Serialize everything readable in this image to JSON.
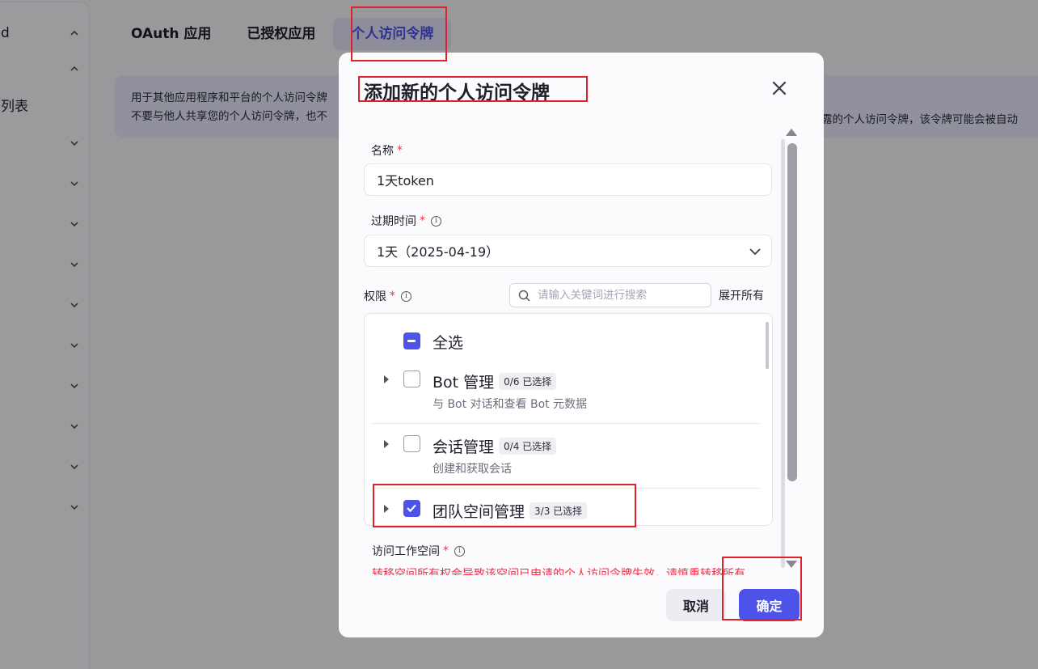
{
  "sidebar": {
    "items": [
      {
        "label": "d",
        "chevron": "chevron-up-icon"
      },
      {
        "label": "",
        "chevron": "chevron-up-icon"
      },
      {
        "label": "列表",
        "chevron": ""
      },
      {
        "label": "",
        "chevron": "chevron-down-icon"
      },
      {
        "label": "",
        "chevron": "chevron-down-icon"
      },
      {
        "label": "",
        "chevron": "chevron-down-icon"
      },
      {
        "label": "",
        "chevron": "chevron-down-icon"
      },
      {
        "label": "",
        "chevron": "chevron-down-icon"
      },
      {
        "label": "",
        "chevron": "chevron-down-icon"
      },
      {
        "label": "",
        "chevron": "chevron-down-icon"
      },
      {
        "label": "",
        "chevron": "chevron-down-icon"
      },
      {
        "label": "",
        "chevron": "chevron-down-icon"
      }
    ]
  },
  "tabs": [
    {
      "label": "OAuth 应用",
      "active": false
    },
    {
      "label": "已授权应用",
      "active": false
    },
    {
      "label": "个人访问令牌",
      "active": true
    }
  ],
  "banner": {
    "line1": "用于其他应用程序和平台的个人访问令牌",
    "line2": "不要与他人共享您的个人访问令牌，也不",
    "line2_tail": "露的个人访问令牌，该令牌可能会被自动"
  },
  "modal": {
    "title": "添加新的个人访问令牌",
    "name_label": "名称",
    "name_value": "1天token",
    "expiry_label": "过期时间",
    "expiry_value": "1天（2025-04-19）",
    "perm_label": "权限",
    "search_placeholder": "请输入关键词进行搜索",
    "expand_all": "展开所有",
    "select_all": "全选",
    "permissions": [
      {
        "name": "Bot 管理",
        "badge": "0/6 已选择",
        "desc": "与 Bot 对话和查看 Bot 元数据",
        "state": "unchecked"
      },
      {
        "name": "会话管理",
        "badge": "0/4 已选择",
        "desc": "创建和获取会话",
        "state": "unchecked"
      },
      {
        "name": "团队空间管理",
        "badge": "3/3 已选择",
        "desc": "",
        "state": "checked"
      }
    ],
    "workspace_label": "访问工作空间",
    "warning": "转移空间所有权会导致该空间已申请的个人访问令牌失效，请慎重转移所有",
    "cancel": "取消",
    "confirm": "确定"
  },
  "colors": {
    "accent": "#4d53e8",
    "required": "#f3304a",
    "highlight": "#e0202a"
  }
}
